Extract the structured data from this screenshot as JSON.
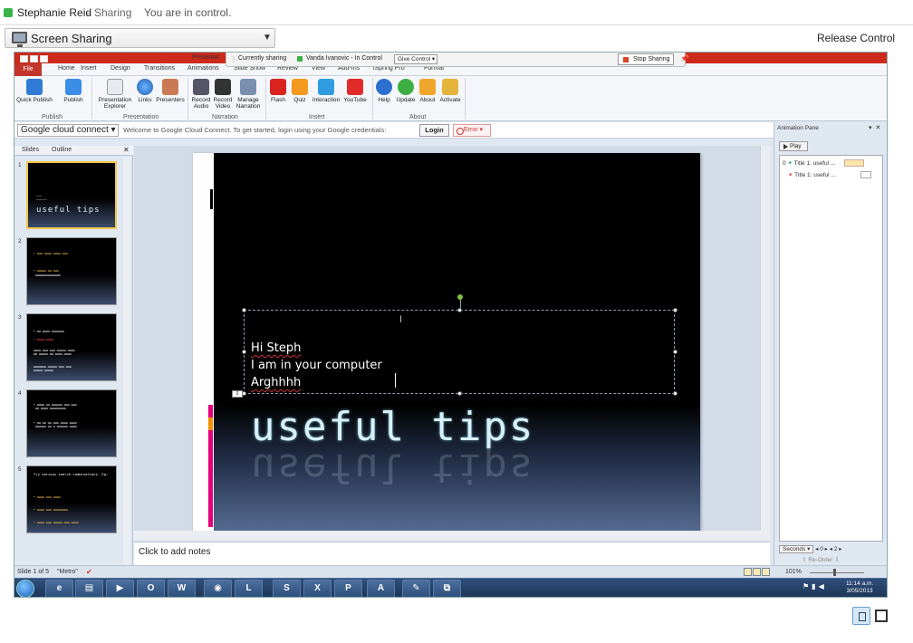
{
  "conversation": {
    "user_name": "Stephanie Reid",
    "separator": "-",
    "mode": "Sharing",
    "status": "You are in control.",
    "status_color": "#3bb34a"
  },
  "screen_sharing": {
    "dropdown_label": "Screen Sharing",
    "release_label": "Release Control"
  },
  "sharing_toolbar": {
    "currently_sharing": "Currently sharing",
    "presenter": "Vanda Ivanovic  - In Control",
    "give_control": "Give Control",
    "stop_sharing": "Stop Sharing"
  },
  "ppt": {
    "accent_color": "#cc2a1b",
    "tabs": [
      "File",
      "Home",
      "Insert",
      "Design",
      "Transitions",
      "Animations",
      "Slide Show",
      "Review",
      "View",
      "Add-Ins",
      "iSpring Pro",
      "Format"
    ],
    "ribbon_title_fragment": "Presentat",
    "ribbon_buttons": [
      {
        "label": "Quick Publish",
        "icon": "quick-publish-icon"
      },
      {
        "label": "Publish",
        "icon": "publish-icon"
      },
      {
        "label": "Presentation Explorer",
        "icon": "presentation-explorer-icon"
      },
      {
        "label": "Links",
        "icon": "links-icon"
      },
      {
        "label": "Presenters",
        "icon": "presenters-icon"
      },
      {
        "label": "Record Audio",
        "icon": "record-audio-icon"
      },
      {
        "label": "Record Video",
        "icon": "record-video-icon"
      },
      {
        "label": "Manage Narration",
        "icon": "manage-narration-icon"
      },
      {
        "label": "Flash",
        "icon": "flash-icon"
      },
      {
        "label": "Quiz",
        "icon": "quiz-icon"
      },
      {
        "label": "Interaction",
        "icon": "interaction-icon"
      },
      {
        "label": "YouTube",
        "icon": "youtube-icon"
      },
      {
        "label": "Help",
        "icon": "help-icon"
      },
      {
        "label": "Update",
        "icon": "update-icon"
      },
      {
        "label": "About",
        "icon": "about-icon"
      },
      {
        "label": "Activate",
        "icon": "activate-icon"
      }
    ],
    "ribbon_groups": [
      "Publish",
      "Presentation",
      "Narration",
      "Insert",
      "About"
    ],
    "gcc": {
      "brand": "Google cloud connect",
      "message": "Welcome to Google Cloud Connect. To get started, login using your Google credentials:",
      "login": "Login",
      "error": "Error"
    },
    "slides_panel": {
      "tabs": [
        "Slides",
        "Outline"
      ],
      "slides": [
        {
          "num": "1",
          "title": "useful tips"
        },
        {
          "num": "2",
          "title": ""
        },
        {
          "num": "3",
          "title": ""
        },
        {
          "num": "4",
          "title": ""
        },
        {
          "num": "5",
          "title": "Try various search combinations. Eg:"
        }
      ]
    },
    "slide": {
      "textbox_lines": [
        "Hi Steph",
        "I am in your computer",
        "Arghhhh"
      ],
      "title": "useful tips",
      "tag": "0"
    },
    "notes_placeholder": "Click to add notes",
    "animation_pane": {
      "title": "Animation Pane",
      "play": "Play",
      "items": [
        {
          "num": "0",
          "label": "Title 1: useful ..."
        },
        {
          "num": "",
          "label": "Title 1: useful ..."
        }
      ],
      "timing": "Seconds",
      "timing_start": "0",
      "timing_end": "2",
      "reorder": "Re-Order"
    },
    "status": {
      "slide": "Slide 1 of 5",
      "theme": "\"Metro\"",
      "zoom": "101%"
    }
  },
  "taskbar": {
    "clock_time": "11:14 a.m.",
    "clock_date": "3/05/2013",
    "apps": [
      "internet-explorer",
      "file-explorer",
      "media-player",
      "outlook",
      "word",
      "chrome",
      "lync",
      "skype",
      "excel",
      "powerpoint",
      "acrobat",
      "ispring",
      "remote-desktop"
    ]
  }
}
